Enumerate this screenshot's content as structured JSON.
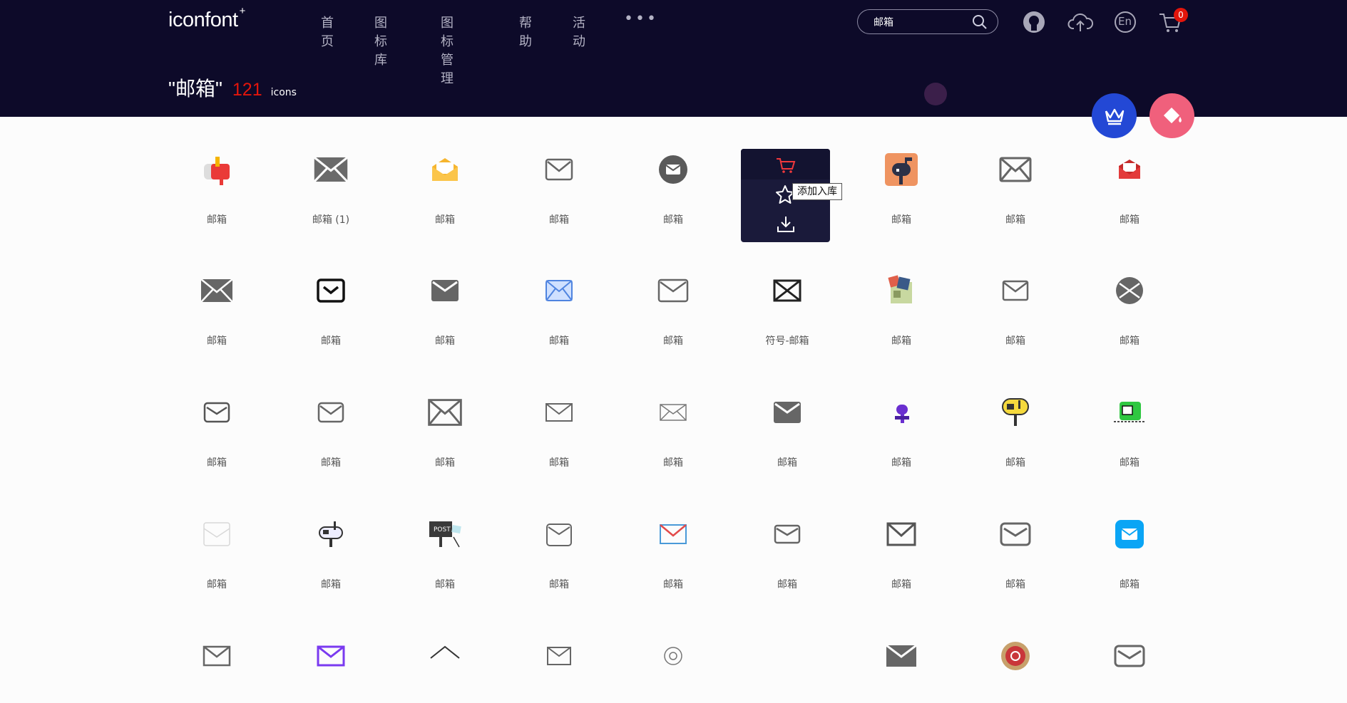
{
  "header": {
    "logo": "iconfont",
    "logo_plus": "+",
    "nav": [
      "首页",
      "图标库",
      "图标管理",
      "帮助",
      "活动"
    ],
    "more": "•••",
    "search": {
      "value": "邮箱",
      "icon": "search-icon"
    },
    "icons": [
      "github-icon",
      "upload-cloud-icon",
      "language-en-icon",
      "cart-icon"
    ],
    "language_label": "En",
    "cart_count": "0"
  },
  "results": {
    "query": "\"邮箱\"",
    "count": "121",
    "unit": "icons"
  },
  "fab": [
    "crown-icon",
    "paint-bucket-icon"
  ],
  "hover_card": {
    "actions": [
      "cart-icon",
      "star-icon",
      "download-icon"
    ],
    "tooltip": "添加入库"
  },
  "icons": [
    {
      "label": "邮箱"
    },
    {
      "label": "邮箱 (1)"
    },
    {
      "label": "邮箱"
    },
    {
      "label": "邮箱"
    },
    {
      "label": "邮箱"
    },
    {
      "label": ""
    },
    {
      "label": "邮箱"
    },
    {
      "label": "邮箱"
    },
    {
      "label": "邮箱"
    },
    {
      "label": "邮箱"
    },
    {
      "label": "邮箱"
    },
    {
      "label": "邮箱"
    },
    {
      "label": "邮箱"
    },
    {
      "label": "邮箱"
    },
    {
      "label": "符号-邮箱"
    },
    {
      "label": "邮箱"
    },
    {
      "label": "邮箱"
    },
    {
      "label": "邮箱"
    },
    {
      "label": "邮箱"
    },
    {
      "label": "邮箱"
    },
    {
      "label": "邮箱"
    },
    {
      "label": "邮箱"
    },
    {
      "label": "邮箱"
    },
    {
      "label": "邮箱"
    },
    {
      "label": "邮箱"
    },
    {
      "label": "邮箱"
    },
    {
      "label": "邮箱"
    },
    {
      "label": "邮箱"
    },
    {
      "label": "邮箱"
    },
    {
      "label": "邮箱"
    },
    {
      "label": "邮箱"
    },
    {
      "label": "邮箱"
    },
    {
      "label": "邮箱"
    },
    {
      "label": "邮箱"
    },
    {
      "label": "邮箱"
    },
    {
      "label": "邮箱"
    },
    {
      "label": ""
    },
    {
      "label": ""
    },
    {
      "label": ""
    },
    {
      "label": ""
    },
    {
      "label": ""
    },
    {
      "label": ""
    },
    {
      "label": ""
    },
    {
      "label": ""
    },
    {
      "label": ""
    }
  ],
  "colors": {
    "header_bg": "#0d0a29",
    "accent_red": "#e3150b",
    "crown_blue": "#2348d5",
    "paint_pink": "#f0607c"
  }
}
